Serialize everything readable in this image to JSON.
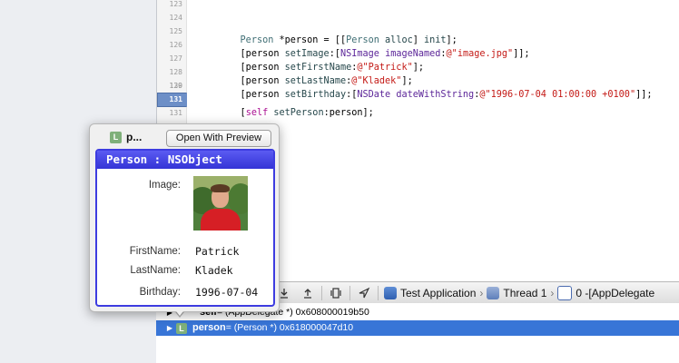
{
  "gutter": {
    "line_numbers": [
      "123",
      "124",
      "125",
      "126",
      "127",
      "128",
      "129",
      "130",
      "131",
      "132",
      "133"
    ]
  },
  "code": {
    "line125": {
      "p1": "Person",
      "p2": " *person = [[",
      "p3": "Person",
      "p4": " ",
      "p5": "alloc",
      "p6": "] ",
      "p7": "init",
      "p8": "];"
    },
    "line126": {
      "p1": "[person ",
      "p2": "setImage",
      "p3": ":[",
      "p4": "NSImage",
      "p5": " ",
      "p6": "imageNamed",
      "p7": ":",
      "p8": "@\"image.jpg\"",
      "p9": "]];"
    },
    "line127": {
      "p1": "[person ",
      "p2": "setFirstName",
      "p3": ":",
      "p4": "@\"Patrick\"",
      "p5": "];"
    },
    "line128": {
      "p1": "[person ",
      "p2": "setLastName",
      "p3": ":",
      "p4": "@\"Kladek\"",
      "p5": "];"
    },
    "line129": {
      "p1": "[person ",
      "p2": "setBirthday",
      "p3": ":[",
      "p4": "NSDate",
      "p5": " ",
      "p6": "dateWithString",
      "p7": ":",
      "p8": "@\"1996-07-04 01:00:00 +0100\"",
      "p9": "]];"
    },
    "line131": {
      "p1": "[",
      "p2": "self",
      "p3": " ",
      "p4": "setPerson",
      "p5": ":person];"
    }
  },
  "popover": {
    "badge": "L",
    "short_name": "p...",
    "open_button_label": "Open With Preview",
    "header": "Person : NSObject",
    "properties": [
      {
        "label": "Image:",
        "value": ""
      },
      {
        "label": "FirstName:",
        "value": "Patrick"
      },
      {
        "label": "LastName:",
        "value": "Kladek"
      },
      {
        "label": "Birthday:",
        "value": "1996-07-04"
      }
    ]
  },
  "debug_bar": {
    "icons": [
      "step-into-icon",
      "step-out-icon",
      "debug-view-hierarchy-icon",
      "simulate-location-icon"
    ],
    "breadcrumbs": [
      "Test Application",
      "Thread 1",
      "0 -[AppDelegate"
    ]
  },
  "variables": {
    "rows": [
      {
        "badge": "",
        "name": "self",
        "type": " = (AppDelegate *) 0x608000019b50",
        "selected": false
      },
      {
        "badge": "L",
        "name": "person",
        "type": " = (Person *) 0x618000047d10",
        "selected": true
      }
    ]
  },
  "colors": {
    "selection_blue": "#3875d7",
    "card_header_blue": "#3d3ce0",
    "current_line_green": "#e2f1d9"
  }
}
